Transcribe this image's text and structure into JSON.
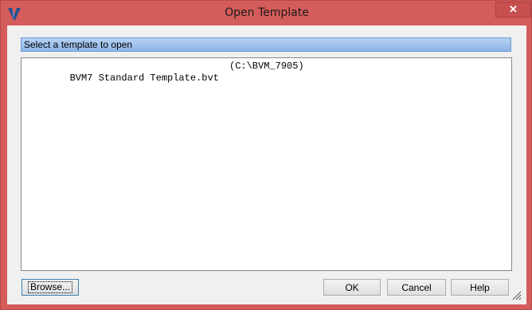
{
  "window": {
    "title": "Open Template",
    "close_label": "✕"
  },
  "header": {
    "label": "Select a template to open"
  },
  "templates": [
    {
      "name": "BVM7 Standard Template.bvt",
      "path": "(C:\\BVM_7905)"
    }
  ],
  "buttons": {
    "browse": "Browse...",
    "ok": "OK",
    "cancel": "Cancel",
    "help": "Help"
  },
  "colors": {
    "title_bar": "#d45c5a",
    "header_bar": "#8cb4e6",
    "client": "#f0f0f0"
  }
}
